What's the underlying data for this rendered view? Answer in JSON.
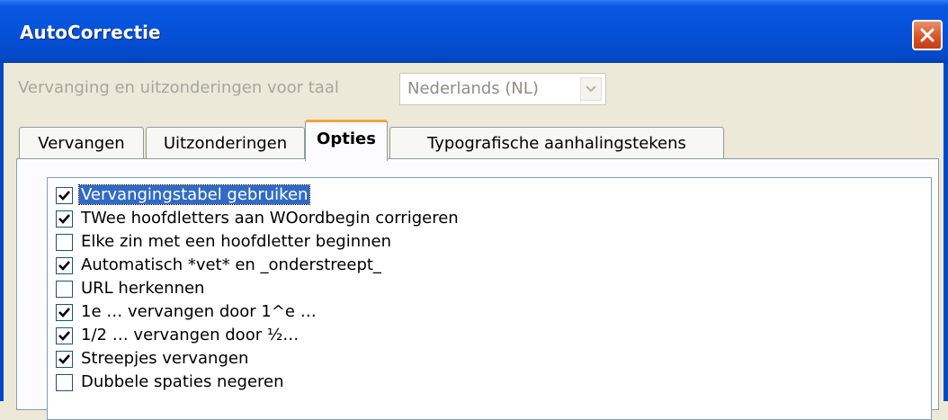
{
  "window": {
    "title": "AutoCorrectie",
    "close_icon": "close-icon"
  },
  "language": {
    "label": "Vervanging en uitzonderingen voor taal",
    "value": "Nederlands (NL)"
  },
  "tabs": [
    {
      "label": "Vervangen",
      "active": false
    },
    {
      "label": "Uitzonderingen",
      "active": false
    },
    {
      "label": "Opties",
      "active": true
    },
    {
      "label": "Typografische aanhalingstekens",
      "active": false
    }
  ],
  "options": [
    {
      "label": "Vervangingstabel gebruiken",
      "checked": true,
      "selected": true
    },
    {
      "label": "TWee hoofdletters aan WOordbegin corrigeren",
      "checked": true
    },
    {
      "label": "Elke zin met een hoofdletter beginnen",
      "checked": false
    },
    {
      "label": "Automatisch *vet* en _onderstreept_",
      "checked": true
    },
    {
      "label": "URL herkennen",
      "checked": false
    },
    {
      "label": "1e … vervangen door 1^e …",
      "checked": true
    },
    {
      "label": "1/2 … vervangen door ½…",
      "checked": true
    },
    {
      "label": "Streepjes vervangen",
      "checked": true
    },
    {
      "label": "Dubbele spaties negeren",
      "checked": false
    }
  ],
  "colors": {
    "titlebar": "#0552D9",
    "tab_highlight": "#F7A43C",
    "selection": "#316AC5",
    "dialog_bg": "#ECE9D8"
  }
}
